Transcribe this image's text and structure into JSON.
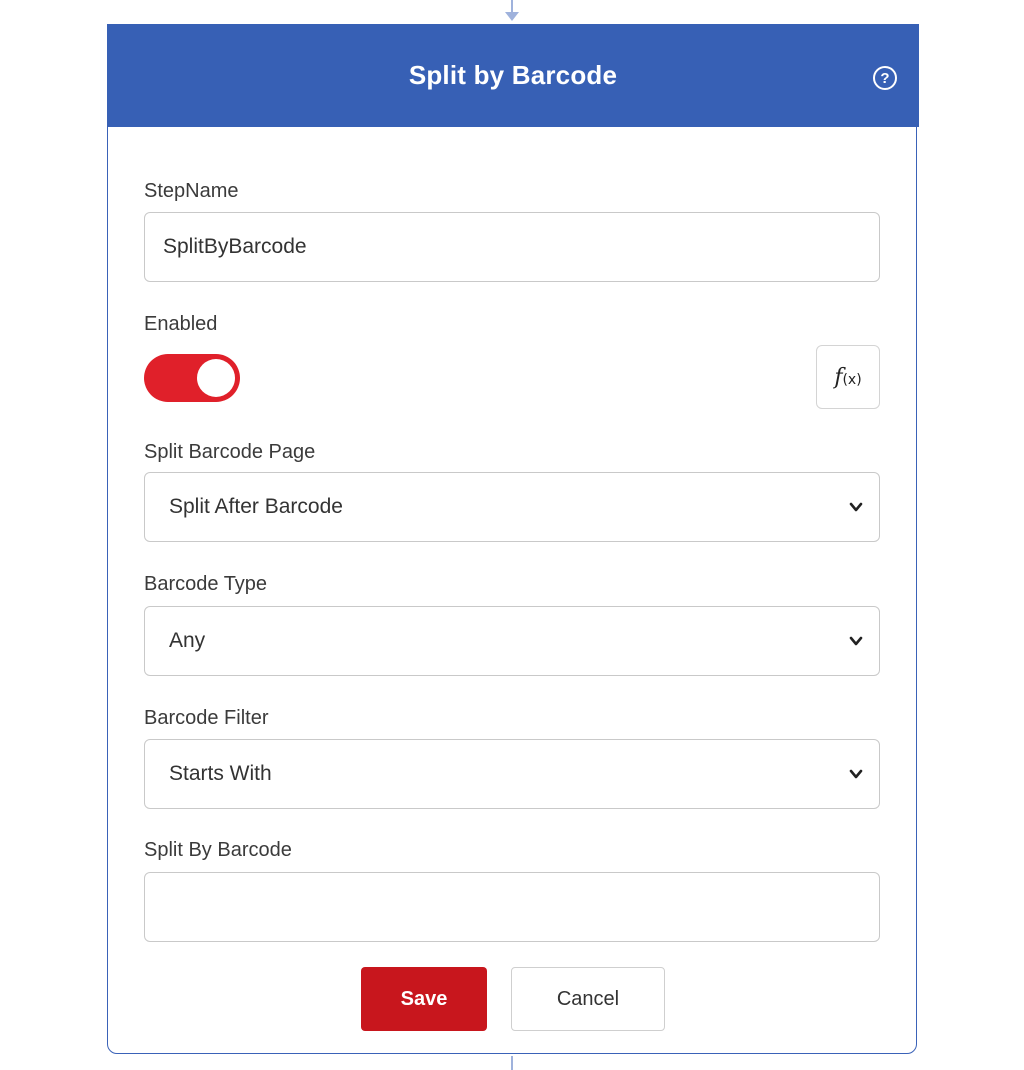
{
  "dialog": {
    "title": "Split by Barcode",
    "help_icon": "?"
  },
  "form": {
    "step_name": {
      "label": "StepName",
      "value": "SplitByBarcode"
    },
    "enabled": {
      "label": "Enabled",
      "on": true,
      "toggle_color": "#e0202a"
    },
    "fx_button": {
      "glyph": "f",
      "suffix": "(x)"
    },
    "split_barcode_page": {
      "label": "Split Barcode Page",
      "selected": "Split After Barcode"
    },
    "barcode_type": {
      "label": "Barcode Type",
      "selected": "Any"
    },
    "barcode_filter": {
      "label": "Barcode Filter",
      "selected": "Starts With"
    },
    "split_by_barcode": {
      "label": "Split By Barcode",
      "value": ""
    }
  },
  "actions": {
    "save_label": "Save",
    "cancel_label": "Cancel"
  },
  "colors": {
    "header": "#3760b5",
    "save": "#c8161d",
    "connector": "#9fb2dc"
  },
  "icons": {
    "help": "question-circle-icon",
    "fx": "function-icon",
    "chevron": "chevron-down-icon"
  }
}
